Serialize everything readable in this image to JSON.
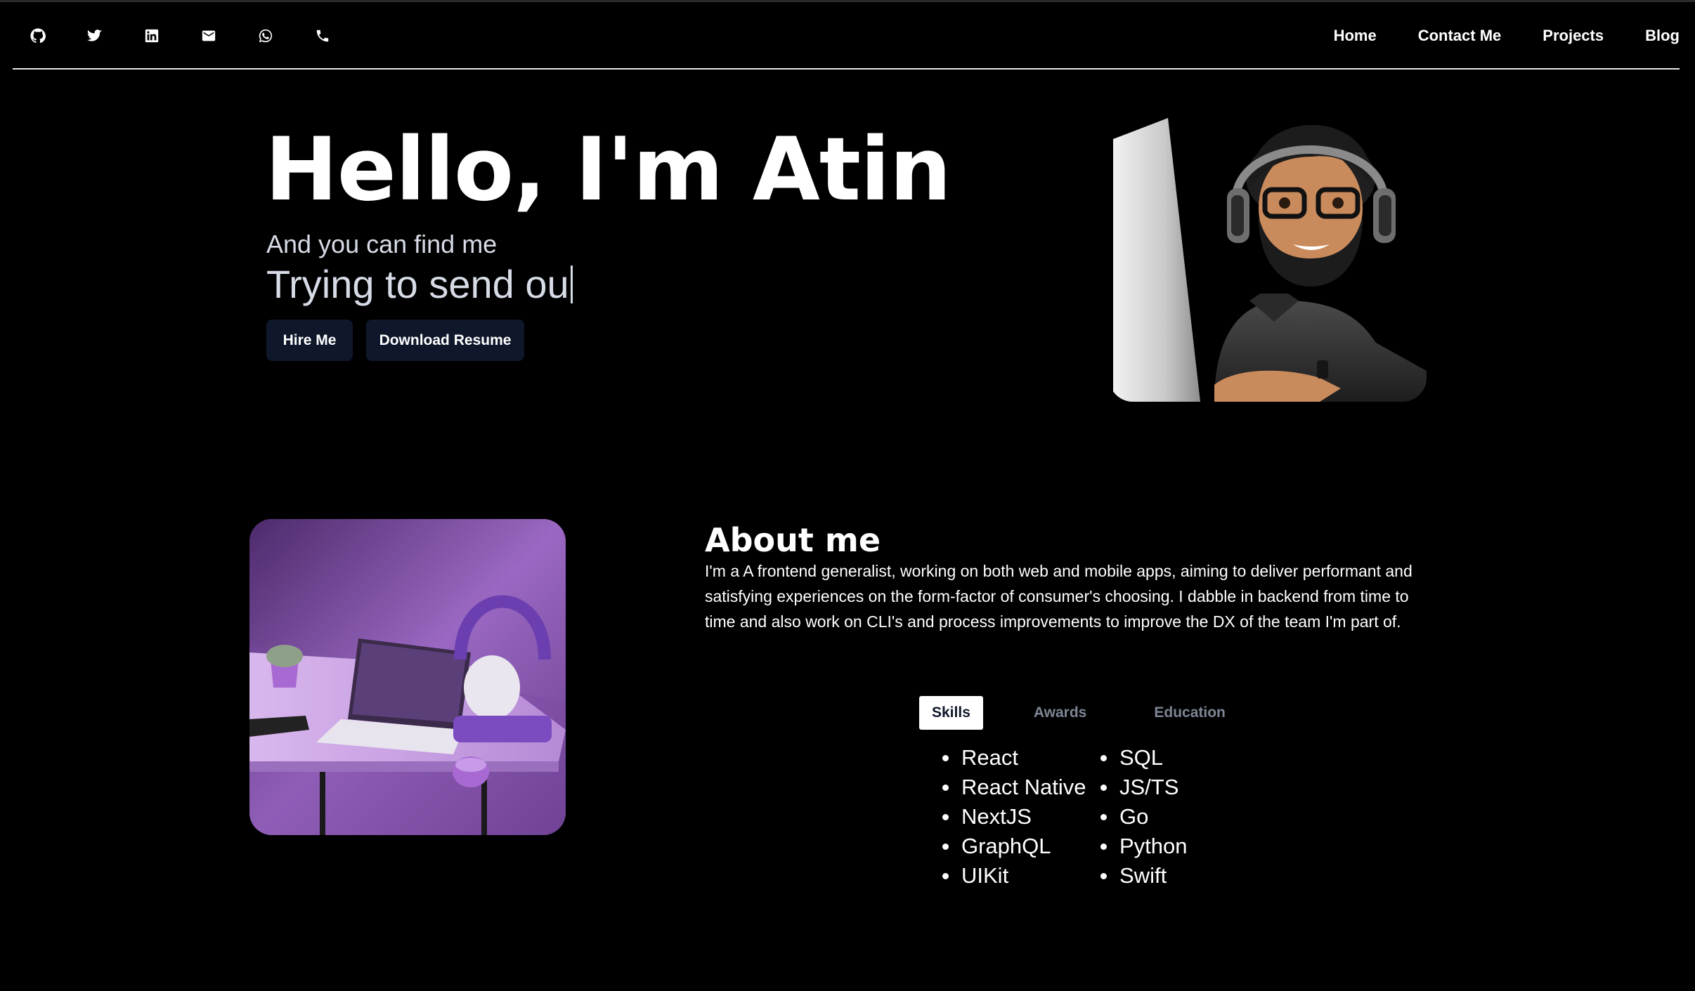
{
  "nav": {
    "social_icons": [
      "github-icon",
      "twitter-icon",
      "linkedin-icon",
      "mail-icon",
      "whatsapp-icon",
      "phone-icon"
    ],
    "links": [
      "Home",
      "Contact Me",
      "Projects",
      "Blog"
    ]
  },
  "hero": {
    "title": "Hello, I'm Atin",
    "subtitle": "And you can find me",
    "typed_text": "Trying to send ou",
    "hire_label": "Hire Me",
    "resume_label": "Download Resume"
  },
  "about": {
    "title": "About me",
    "text": "I'm a A frontend generalist, working on both web and mobile apps, aiming to deliver performant and satisfying experiences on the form-factor of consumer's choosing. I dabble in backend from time to time and also work on CLI's and process improvements to improve the DX of the team I'm part of.",
    "tabs": [
      "Skills",
      "Awards",
      "Education"
    ],
    "active_tab": "Skills",
    "skills_col1": [
      "React",
      "React Native",
      "NextJS",
      "GraphQL",
      "UIKit"
    ],
    "skills_col2": [
      "SQL",
      "JS/TS",
      "Go",
      "Python",
      "Swift"
    ]
  },
  "colors": {
    "background": "#000000",
    "button_bg": "#0f172a",
    "muted_text": "#d6dbe6",
    "inactive_tab": "#7d8595"
  }
}
